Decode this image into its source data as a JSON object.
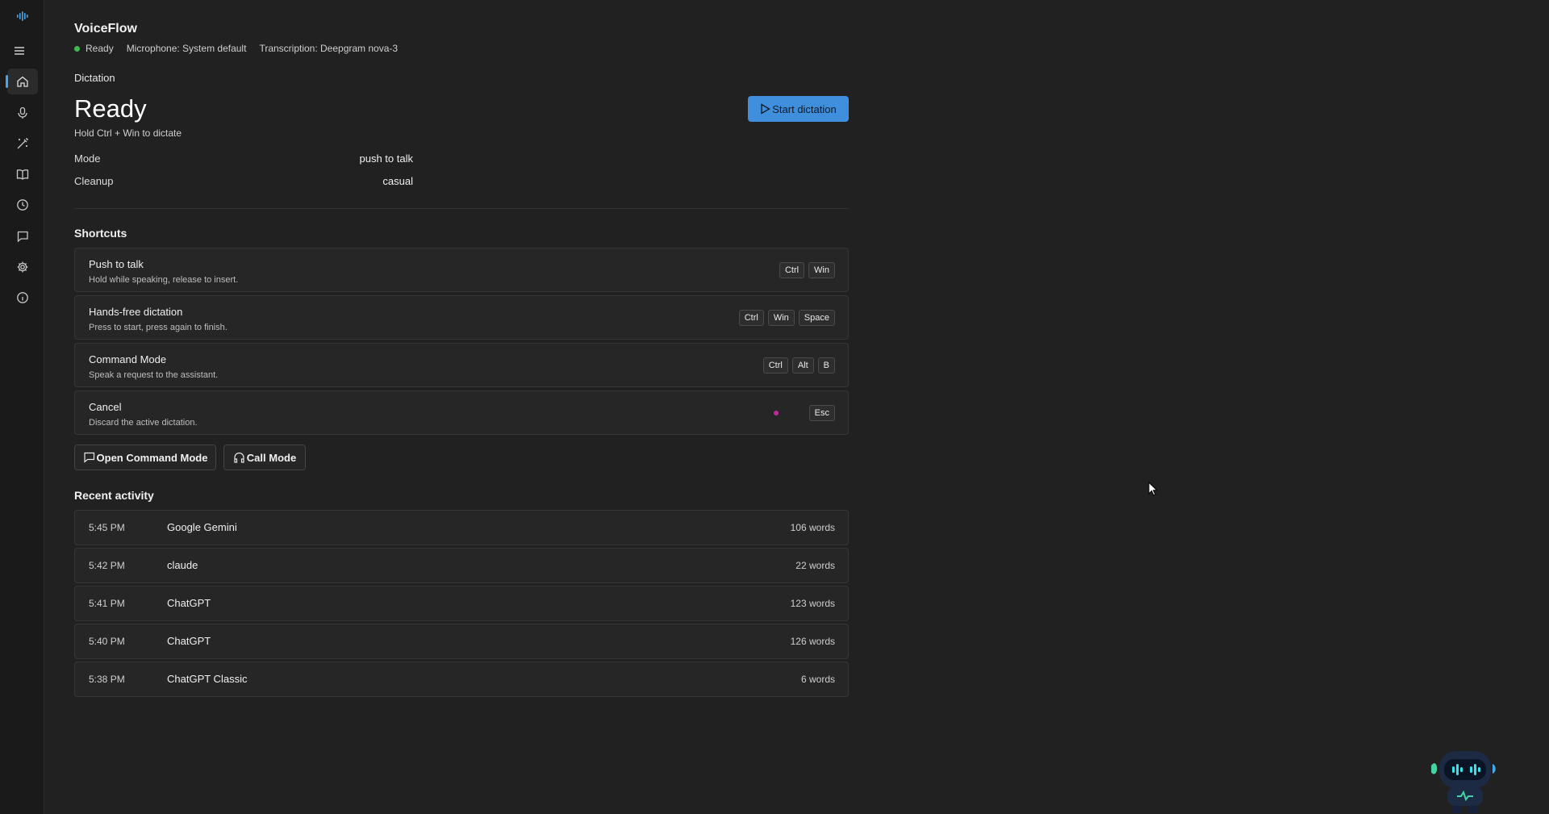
{
  "app": {
    "title": "VoiceFlow",
    "status": "Ready",
    "microphone": "Microphone: System default",
    "transcription": "Transcription: Deepgram nova-3"
  },
  "sidebar": {
    "items": [
      {
        "icon": "waveform-logo-icon"
      },
      {
        "icon": "menu-icon"
      },
      {
        "icon": "home-icon",
        "active": true
      },
      {
        "icon": "microphone-icon"
      },
      {
        "icon": "magic-wand-icon"
      },
      {
        "icon": "book-icon"
      },
      {
        "icon": "clock-icon"
      },
      {
        "icon": "chat-icon"
      },
      {
        "icon": "gear-icon"
      },
      {
        "icon": "info-icon"
      }
    ]
  },
  "dictation": {
    "section_label": "Dictation",
    "state": "Ready",
    "hint": "Hold Ctrl + Win to dictate",
    "start_button": "Start dictation",
    "mode_label": "Mode",
    "mode_value": "push to talk",
    "cleanup_label": "Cleanup",
    "cleanup_value": "casual"
  },
  "shortcuts": {
    "heading": "Shortcuts",
    "items": [
      {
        "title": "Push to talk",
        "desc": "Hold while speaking, release to insert.",
        "keys": [
          "Ctrl",
          "Win"
        ]
      },
      {
        "title": "Hands-free dictation",
        "desc": "Press to start, press again to finish.",
        "keys": [
          "Ctrl",
          "Win",
          "Space"
        ]
      },
      {
        "title": "Command Mode",
        "desc": "Speak a request to the assistant.",
        "keys": [
          "Ctrl",
          "Alt",
          "B"
        ]
      },
      {
        "title": "Cancel",
        "desc": "Discard the active dictation.",
        "keys": [
          "Esc"
        ]
      }
    ]
  },
  "actions": {
    "command_mode": "Open Command Mode",
    "call_mode": "Call Mode"
  },
  "recent": {
    "heading": "Recent activity",
    "rows": [
      {
        "time": "5:45 PM",
        "app": "Google Gemini",
        "words": "106 words"
      },
      {
        "time": "5:42 PM",
        "app": "claude",
        "words": "22 words"
      },
      {
        "time": "5:41 PM",
        "app": "ChatGPT",
        "words": "123 words"
      },
      {
        "time": "5:40 PM",
        "app": "ChatGPT",
        "words": "126 words"
      },
      {
        "time": "5:38 PM",
        "app": "ChatGPT Classic",
        "words": "6 words"
      }
    ]
  },
  "colors": {
    "accent": "#3f8fdd",
    "status_ready": "#3fb950",
    "background": "#212121"
  }
}
